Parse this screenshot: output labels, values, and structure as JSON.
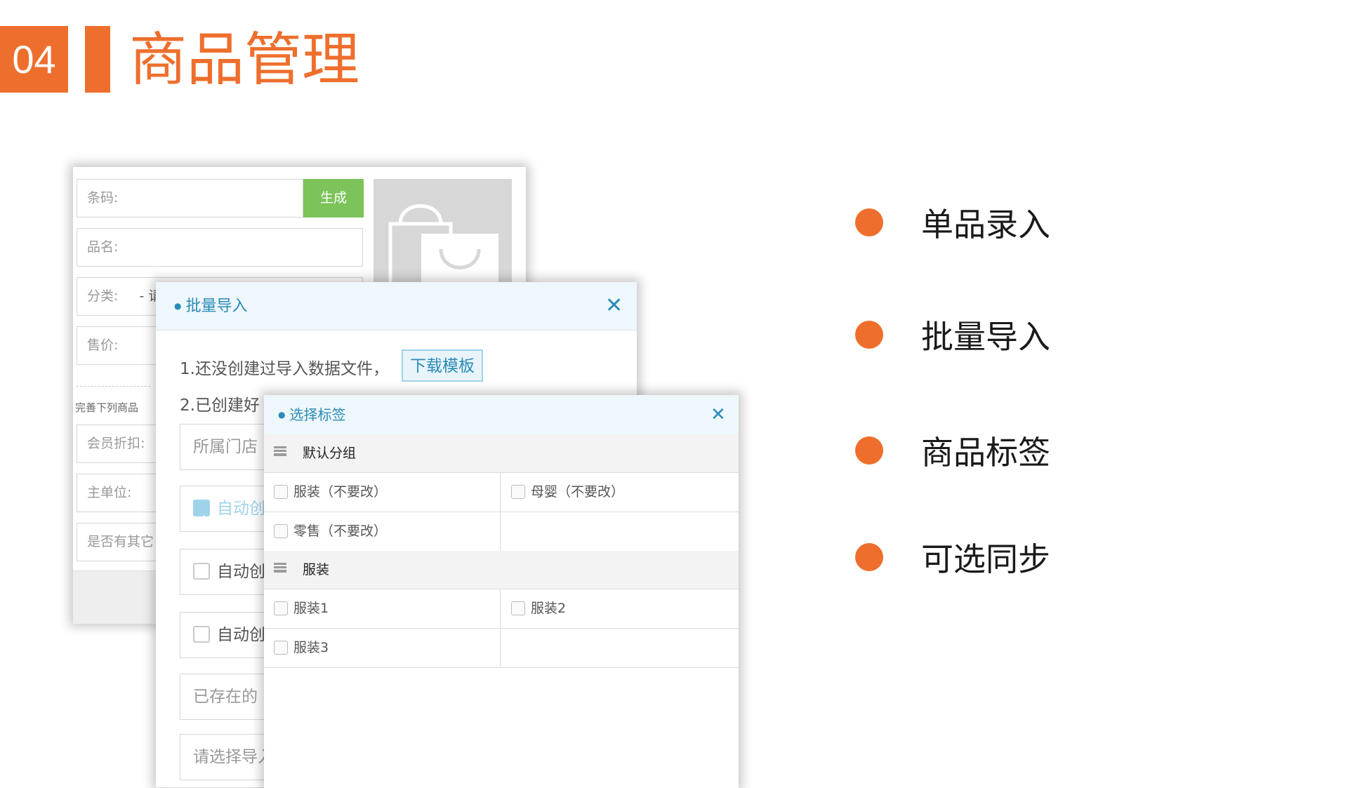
{
  "header": {
    "number": "04",
    "title": "商品管理"
  },
  "bullets": [
    "单品录入",
    "批量导入",
    "商品标签",
    "可选同步"
  ],
  "product_form": {
    "barcode_label": "条码:",
    "generate_button": "生成",
    "name_label": "品名:",
    "category_label": "分类:",
    "category_value": "- 请",
    "price_label": "售价:",
    "hint": "完善下列商品",
    "member_discount_label": "会员折扣:",
    "main_unit_label": "主单位:",
    "has_other_label": "是否有其它"
  },
  "batch_import": {
    "title": "批量导入",
    "step1": "1.还没创建过导入数据文件，",
    "download_template_button": "下载模板",
    "step2": "2.已创建好",
    "store_field": "所属门店",
    "option1": "自动创",
    "option2": "自动创",
    "option3": "自动创",
    "existing_field": "已存在的",
    "select_field": "请选择导入"
  },
  "tag_selector": {
    "title": "选择标签",
    "groups": [
      {
        "name": "默认分组",
        "rows": [
          [
            "服装（不要改）",
            "母婴（不要改）"
          ],
          [
            "零售（不要改）",
            ""
          ]
        ]
      },
      {
        "name": "服装",
        "rows": [
          [
            "服装1",
            "服装2"
          ],
          [
            "服装3",
            ""
          ]
        ]
      }
    ]
  },
  "colors": {
    "accent": "#ee6f2d",
    "dialog_blue": "#2a8bb8",
    "generate_green": "#7cc35a"
  }
}
